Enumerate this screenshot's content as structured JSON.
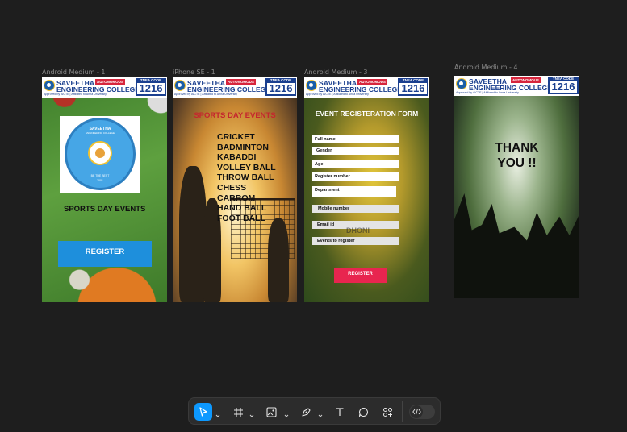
{
  "frames": [
    {
      "label": "Android Medium - 1"
    },
    {
      "label": "iPhone SE - 1"
    },
    {
      "label": "Android Medium - 3"
    },
    {
      "label": "Android Medium - 4"
    }
  ],
  "banner": {
    "college_line1": "SAVEETHA",
    "autonomous": "AUTONOMOUS",
    "college_line2": "ENGINEERING COLLEGE",
    "approved": "Approved by AICTE | Affiliated to Anna University",
    "tnea_label": "TNEA CODE",
    "tnea_code": "1216"
  },
  "frame1": {
    "logo_name": "SAVEETHA",
    "logo_sub": "ENGINEERING COLLEGE",
    "logo_motto": "BE THE BEST",
    "logo_year": "2001",
    "title": "SPORTS DAY EVENTS",
    "register_label": "REGISTER"
  },
  "frame2": {
    "headline": "SPORTS DAY EVENTS",
    "sports": [
      "CRICKET",
      "BADMINTON",
      "KABADDI",
      "VOLLEY BALL",
      "THROW BALL",
      "CHESS",
      "CARROM",
      "HAND BALL",
      "FOOT BALL"
    ]
  },
  "frame3": {
    "title": "EVENT REGISTERATION FORM",
    "fields": [
      "Full name",
      "Gender",
      "Age",
      "Register number",
      "Department",
      "Mobile number",
      "Email id",
      "Events to register"
    ],
    "watermark": "DHONI",
    "submit_label": "REGISTER"
  },
  "frame4": {
    "thanks_line1": "THANK",
    "thanks_line2": "YOU !!"
  },
  "toolbar": {
    "tools": [
      "move-tool",
      "frame-tool",
      "image-tool",
      "pen-tool",
      "text-tool",
      "comment-tool",
      "actions-tool",
      "dev-mode-toggle"
    ],
    "accent": "#0d99ff"
  }
}
